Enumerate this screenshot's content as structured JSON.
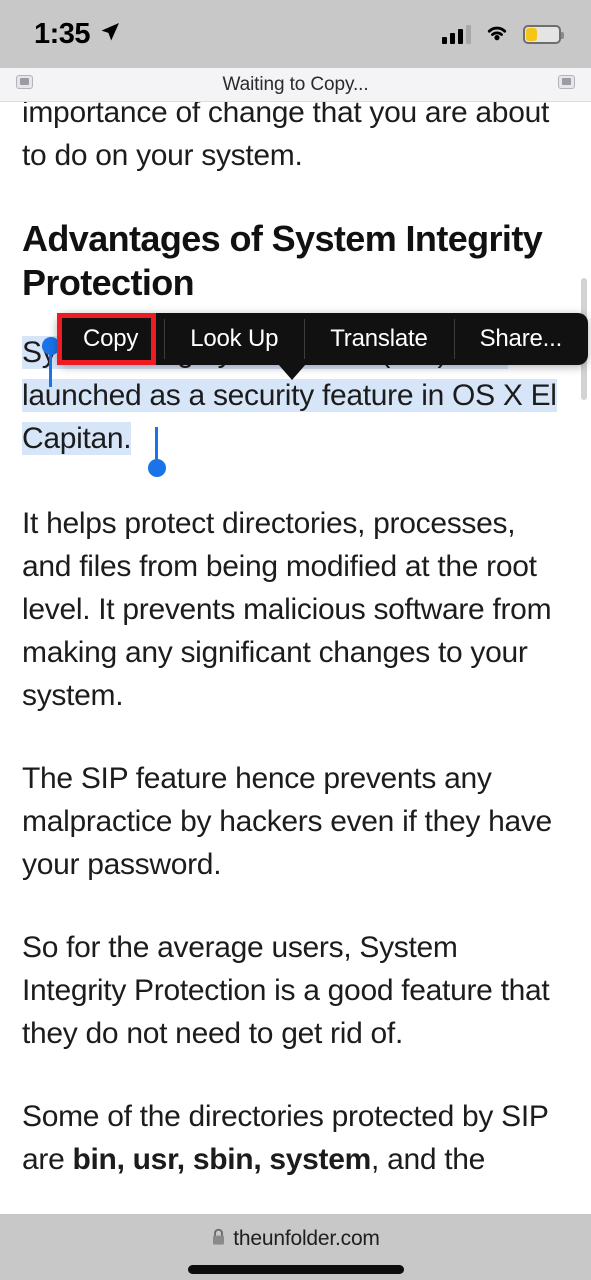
{
  "status_bar": {
    "time": "1:35",
    "location_icon": "location-arrow-icon",
    "cellular_icon": "cellular-bars-icon",
    "wifi_icon": "wifi-icon",
    "battery_icon": "battery-low-power-icon"
  },
  "browser": {
    "toolbar_status": "Waiting to Copy...",
    "left_placeholder_icon": "broken-image-icon",
    "right_placeholder_icon": "broken-image-icon",
    "url": "theunfolder.com",
    "lock_icon": "lock-icon",
    "home_indicator": "home-indicator"
  },
  "article": {
    "paragraph_top": "process, let us first discuss the importance of change that you are about to do on your system.",
    "heading": "Advantages of System Integrity Protection",
    "selected_text": "System Integrity Protection (SIP) was launched as a security feature in OS X El Capitan.",
    "paragraph_2": "It helps protect directories, processes, and files from being modified at the root level. It prevents malicious software from making any significant changes to your system.",
    "paragraph_3": "The SIP feature hence prevents any malpractice by hackers even if they have your password.",
    "paragraph_4": "So for the average users, System Integrity Protection is a good feature that they do not need to get rid of.",
    "paragraph_5_part1": "Some of the directories protected by SIP are ",
    "paragraph_5_bold": "bin, usr, sbin, system",
    "paragraph_5_part2": ", and the"
  },
  "context_menu": {
    "items": [
      {
        "label": "Copy"
      },
      {
        "label": "Look Up"
      },
      {
        "label": "Translate"
      },
      {
        "label": "Share..."
      }
    ],
    "highlighted_item": "Copy",
    "highlight_color": "#ee1b22"
  },
  "colors": {
    "selection_highlight": "#d7e5f8",
    "selection_handle": "#1a73e8",
    "menu_background": "#111111",
    "status_bar_background": "#c8c8c8",
    "battery_fill": "#f5c518"
  }
}
